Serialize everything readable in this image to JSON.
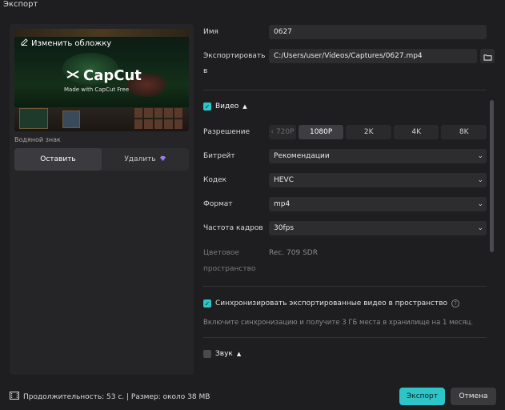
{
  "window": {
    "title": "Экспорт"
  },
  "cover": {
    "edit_label": "Изменить обложку",
    "watermark_brand": "CapCut",
    "watermark_sub": "Made with CapCut Free"
  },
  "watermark": {
    "label": "Водяной знак",
    "options": [
      {
        "label": "Оставить",
        "selected": true
      },
      {
        "label": "Удалить",
        "selected": false
      }
    ]
  },
  "form": {
    "name_label": "Имя",
    "name_value": "0627",
    "export_label_1": "Экспортировать",
    "export_label_2": "в",
    "export_path": "C:/Users/user/Videos/Captures/0627.mp4"
  },
  "video": {
    "section_label": "Видео",
    "checked": true,
    "resolution_label": "Разрешение",
    "resolutions": [
      "720P",
      "1080P",
      "2K",
      "4K",
      "8K"
    ],
    "resolution_selected": "1080P",
    "bitrate_label": "Битрейт",
    "bitrate_value": "Рекомендации",
    "codec_label": "Кодек",
    "codec_value": "HEVC",
    "format_label": "Формат",
    "format_value": "mp4",
    "fps_label": "Частота кадров",
    "fps_value": "30fps",
    "colorspace_label_1": "Цветовое",
    "colorspace_label_2": "пространство",
    "colorspace_value": "Rec. 709 SDR"
  },
  "sync": {
    "label": "Синхронизировать экспортированные видео в пространство",
    "checked": true,
    "hint": "Включите синхронизацию и получите 3 ГБ места в хранилище на 1 месяц."
  },
  "audio": {
    "section_label": "Звук",
    "checked": false
  },
  "footer": {
    "info": "Продолжительность: 53 с. | Размер: около 38 MB",
    "export_label": "Экспорт",
    "cancel_label": "Отмена"
  },
  "colors": {
    "accent": "#2ec5c8",
    "background": "#1e1e20",
    "panel": "#252527"
  }
}
